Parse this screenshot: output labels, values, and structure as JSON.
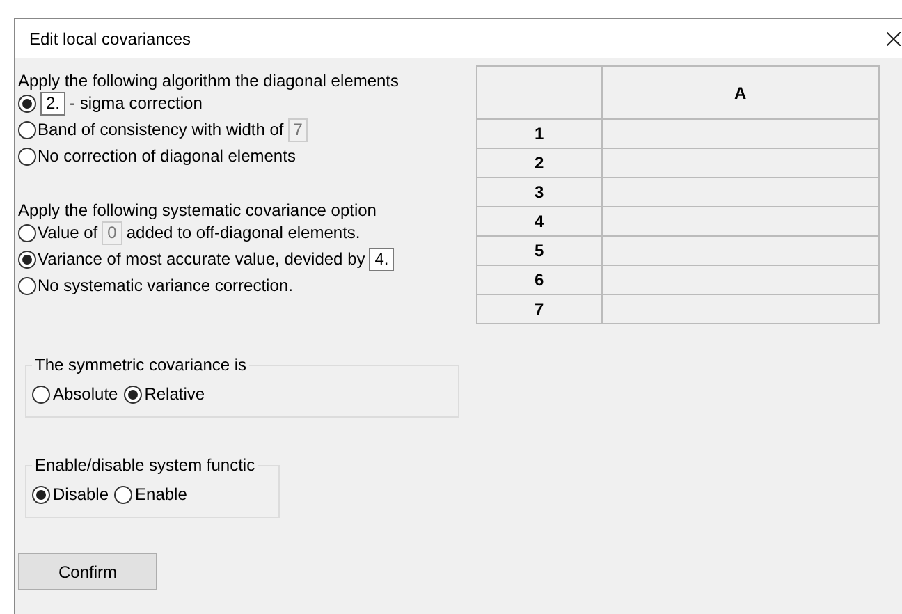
{
  "window": {
    "title": "Edit local covariances"
  },
  "diagonal": {
    "heading": "Apply the following algorithm the diagonal elements",
    "options": [
      {
        "selected": true,
        "value": "2.",
        "value_disabled": false,
        "after": "- sigma correction"
      },
      {
        "selected": false,
        "before": "Band of consistency with width of",
        "value": "7",
        "value_disabled": true
      },
      {
        "selected": false,
        "before": "No correction of diagonal elements"
      }
    ]
  },
  "systematic": {
    "heading": "Apply the following systematic covariance option",
    "options": [
      {
        "selected": false,
        "before": "Value of",
        "value": "0",
        "value_disabled": true,
        "after": "added to off-diagonal elements."
      },
      {
        "selected": true,
        "before": "Variance of most accurate value, devided by",
        "value": "4.",
        "value_disabled": false
      },
      {
        "selected": false,
        "before": "No systematic variance correction."
      }
    ]
  },
  "table": {
    "columns": [
      "A"
    ],
    "rows": [
      "1",
      "2",
      "3",
      "4",
      "5",
      "6",
      "7"
    ]
  },
  "symmetric": {
    "legend": "The symmetric covariance is",
    "options": [
      {
        "label": "Absolute",
        "selected": false
      },
      {
        "label": "Relative",
        "selected": true
      }
    ]
  },
  "system": {
    "legend": "Enable/disable system functic",
    "options": [
      {
        "label": "Disable",
        "selected": true
      },
      {
        "label": "Enable",
        "selected": false
      }
    ]
  },
  "button": "Confirm"
}
